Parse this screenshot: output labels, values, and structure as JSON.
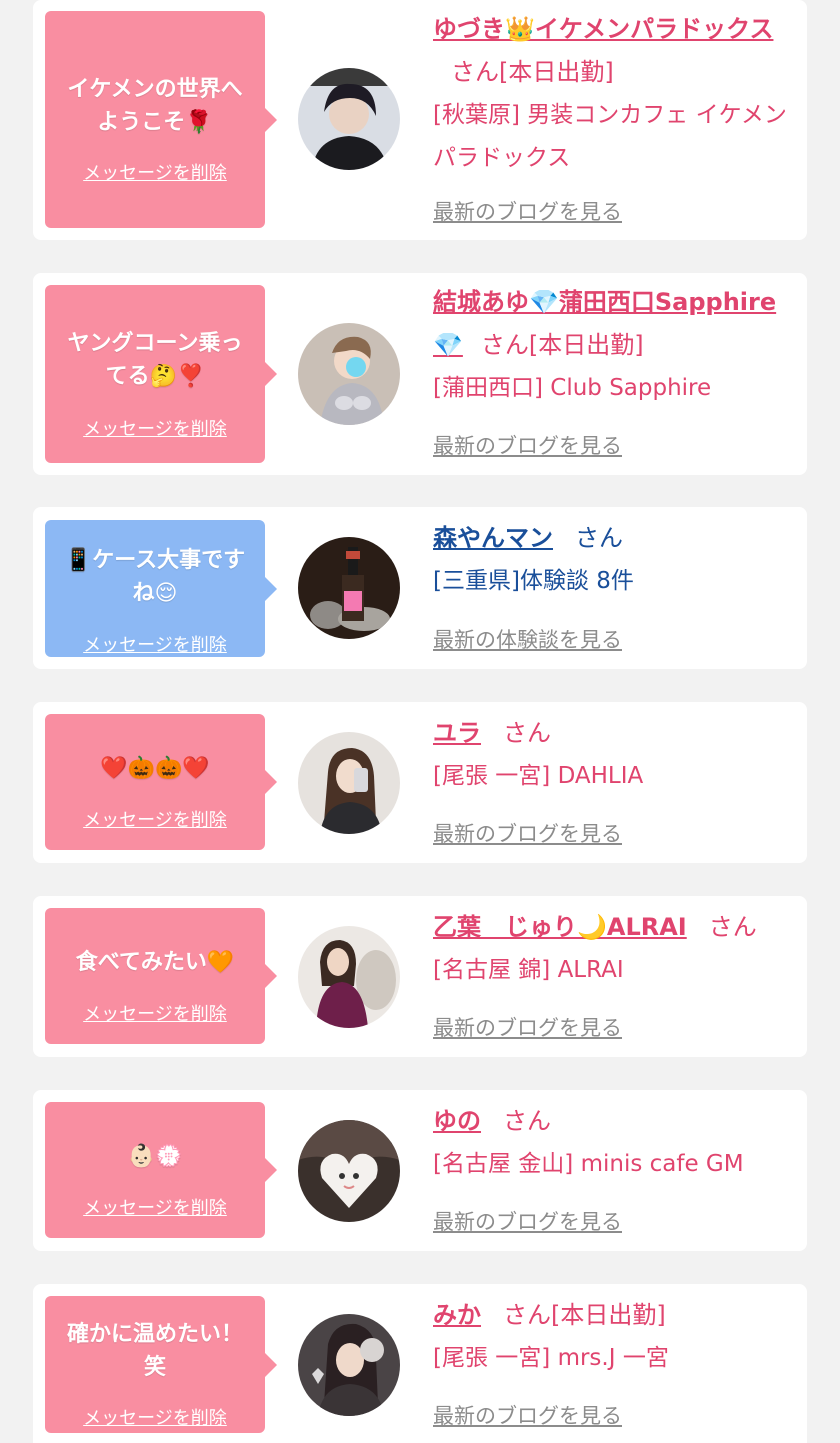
{
  "cards": [
    {
      "message": "イケメンの世界へ\nようこそ🌹",
      "delete_label": "メッセージを削除",
      "name": "ゆづき👑イケメンパラドックス",
      "suffix": "さん[本日出勤]",
      "shop": "[秋葉原] 男装コンカフェ イケメンパラドックス",
      "blog_link": "最新のブログを見る",
      "bubble_color": "pink"
    },
    {
      "message": "ヤングコーン乗っ\nてる🤔❣️",
      "delete_label": "メッセージを削除",
      "name": "結城あゆ💎蒲田西口Sapphire💎",
      "suffix": "さん[本日出勤]",
      "shop": "[蒲田西口] Club Sapphire",
      "blog_link": "最新のブログを見る",
      "bubble_color": "pink"
    },
    {
      "message": "📱ケース大事です\nね😌",
      "delete_label": "メッセージを削除",
      "name": "森やんマン",
      "suffix": "さん",
      "shop": "[三重県]体験談 8件",
      "blog_link": "最新の体験談を見る",
      "bubble_color": "blue"
    },
    {
      "message": "❤️🎃🎃❤️",
      "delete_label": "メッセージを削除",
      "name": "ユラ",
      "suffix": "さん",
      "shop": "[尾張 一宮] DAHLIA",
      "blog_link": "最新のブログを見る",
      "bubble_color": "pink"
    },
    {
      "message": "食べてみたい🧡",
      "delete_label": "メッセージを削除",
      "name": "乙葉　じゅり🌙ALRAI",
      "suffix": "さん",
      "shop": "[名古屋 錦] ALRAI",
      "blog_link": "最新のブログを見る",
      "bubble_color": "pink"
    },
    {
      "message": "👶🏻💮",
      "delete_label": "メッセージを削除",
      "name": "ゆの",
      "suffix": "さん",
      "shop": "[名古屋 金山] minis cafe GM",
      "blog_link": "最新のブログを見る",
      "bubble_color": "pink"
    },
    {
      "message": "確かに温めたい！\n笑",
      "delete_label": "メッセージを削除",
      "name": "みか",
      "suffix": "さん[本日出勤]",
      "shop": "[尾張 一宮] mrs.J 一宮",
      "blog_link": "最新のブログを見る",
      "bubble_color": "pink"
    }
  ],
  "colors": {
    "accent": "#e0446e",
    "link_blue": "#1a4f9a",
    "bubble_pink": "#f98ea1",
    "bubble_blue": "#8cb8f4",
    "muted": "#8c8c8c"
  }
}
